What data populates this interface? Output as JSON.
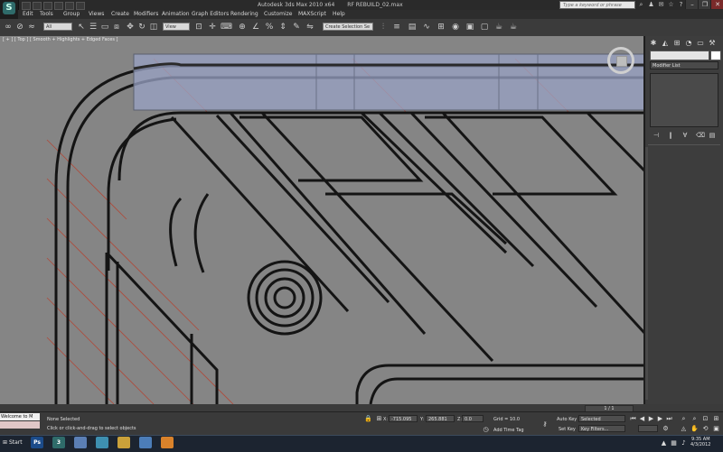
{
  "app": {
    "title": "Autodesk 3ds Max  2010 x64",
    "file": "RF REBUILD_02.max",
    "logo": "3ds-max-logo",
    "search_placeholder": "Type a keyword or phrase"
  },
  "menu": [
    "Edit",
    "Tools",
    "Group",
    "Views",
    "Create",
    "Modifiers",
    "Animation",
    "Graph Editors",
    "Rendering",
    "Customize",
    "MAXScript",
    "Help"
  ],
  "toolbar": {
    "selection_filter": "All",
    "reference_coord": "View",
    "named_selection": "Create Selection Se"
  },
  "viewport": {
    "label": "[ + ] [ Top ] [ Smooth + Highlights + Edged Faces ]",
    "background": "#858585",
    "highlight": "#9aa3c6"
  },
  "command_panel": {
    "modifier_list": "Modifier List"
  },
  "timeline": {
    "frame": "1 / 1"
  },
  "status": {
    "maxscript_text": "Welcome to M",
    "selection": "None Selected",
    "prompt": "Click or click-and-drag to select objects",
    "x_label": "X:",
    "x_value": "-715.095",
    "y_label": "Y:",
    "y_value": "265.881",
    "z_label": "Z:",
    "z_value": "0.0",
    "grid": "Grid = 10.0",
    "add_time_tag": "Add Time Tag",
    "auto_key": "Auto Key",
    "set_key": "Set Key",
    "key_mode": "Selected",
    "key_filters": "Key Filters..."
  },
  "taskbar": {
    "start": "Start",
    "apps": [
      {
        "label": "Ps",
        "color": "#1b4b8a"
      },
      {
        "label": "3",
        "color": "#2f6b6a"
      },
      {
        "label": "",
        "color": "#5b7fb5"
      },
      {
        "label": "",
        "color": "#3e8fb0"
      },
      {
        "label": "",
        "color": "#caa13a"
      },
      {
        "label": "",
        "color": "#4c7db8"
      },
      {
        "label": "",
        "color": "#d9822b"
      }
    ],
    "time": "9:35 AM",
    "date": "4/3/2012"
  }
}
